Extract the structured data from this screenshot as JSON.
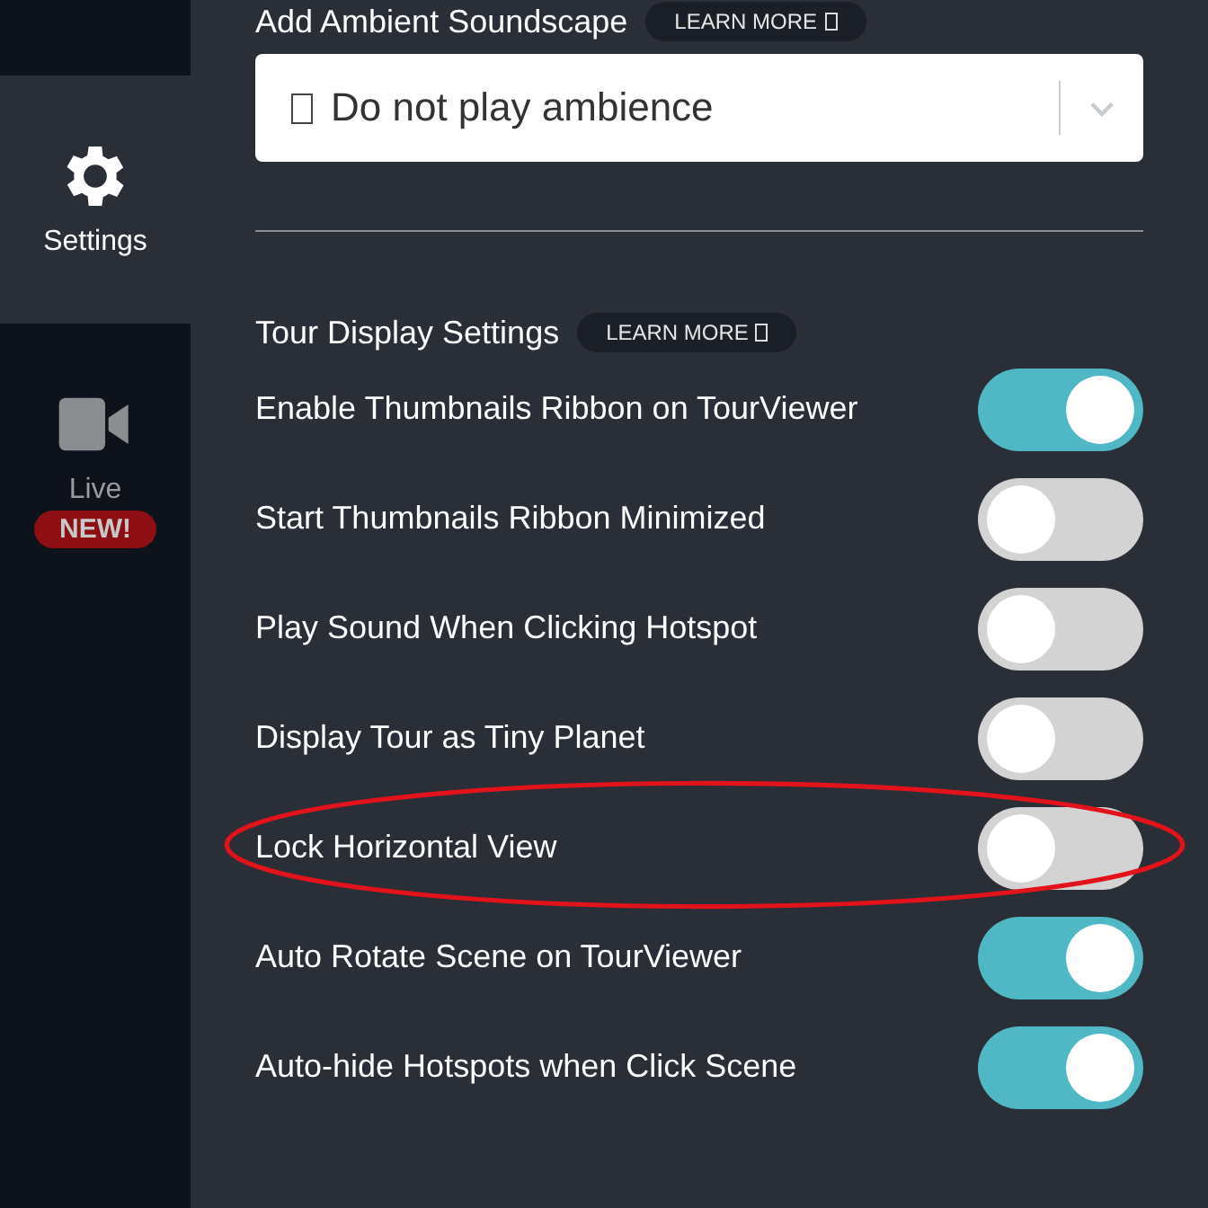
{
  "sidebar": {
    "items": [
      {
        "kind": "settings",
        "label": "Settings",
        "selected": true
      },
      {
        "kind": "live",
        "label": "Live",
        "badge": "NEW!",
        "selected": false
      }
    ]
  },
  "soundscape": {
    "title": "Add Ambient Soundscape",
    "learn_more": "LEARN MORE",
    "value": "Do not play ambience"
  },
  "display": {
    "title": "Tour Display Settings",
    "learn_more": "LEARN MORE",
    "settings": [
      {
        "label": "Enable Thumbnails Ribbon on TourViewer",
        "on": true
      },
      {
        "label": "Start Thumbnails Ribbon Minimized",
        "on": false
      },
      {
        "label": "Play Sound When Clicking Hotspot",
        "on": false
      },
      {
        "label": "Display Tour as Tiny Planet",
        "on": false
      },
      {
        "label": "Lock Horizontal View",
        "on": false,
        "highlighted": true
      },
      {
        "label": "Auto Rotate Scene on TourViewer",
        "on": true
      },
      {
        "label": "Auto-hide Hotspots when Click Scene",
        "on": true
      }
    ]
  }
}
